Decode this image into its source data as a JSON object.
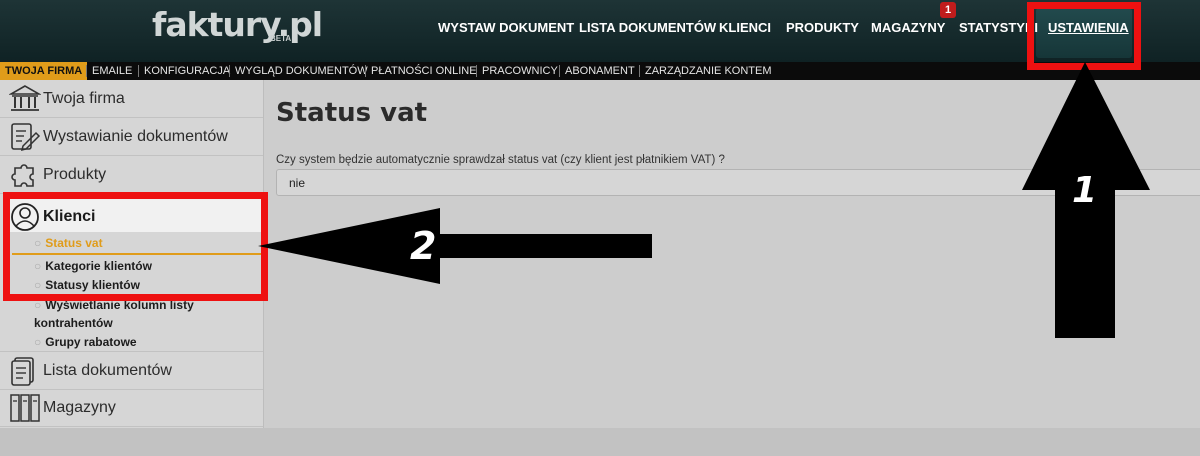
{
  "app": {
    "logo": "faktury.pl",
    "logo_badge": "BETA"
  },
  "topnav": {
    "items": [
      {
        "label": "WYSTAW DOKUMENT"
      },
      {
        "label": "LISTA DOKUMENTÓW"
      },
      {
        "label": "KLIENCI"
      },
      {
        "label": "PRODUKTY"
      },
      {
        "label": "MAGAZYNY"
      },
      {
        "label": "STATYSTYKI"
      },
      {
        "label": "USTAWIENIA"
      }
    ],
    "magazyny_badge": "1",
    "active": "USTAWIENIA"
  },
  "subnav": {
    "items": [
      {
        "label": "TWOJA FIRMA"
      },
      {
        "label": "EMAILE"
      },
      {
        "label": "KONFIGURACJA"
      },
      {
        "label": "WYGLĄD DOKUMENTÓW"
      },
      {
        "label": "PŁATNOŚCI ONLINE"
      },
      {
        "label": "PRACOWNICY"
      },
      {
        "label": "ABONAMENT"
      },
      {
        "label": "ZARZĄDZANIE KONTEM"
      }
    ]
  },
  "sidebar": {
    "items": [
      {
        "label": "Twoja firma",
        "icon": "bank-icon"
      },
      {
        "label": "Wystawianie dokumentów",
        "icon": "document-edit-icon"
      },
      {
        "label": "Produkty",
        "icon": "puzzle-icon"
      },
      {
        "label": "Klienci",
        "icon": "user-icon"
      },
      {
        "label": "Lista dokumentów",
        "icon": "document-list-icon"
      },
      {
        "label": "Magazyny",
        "icon": "binders-icon"
      }
    ],
    "klienci_sub": [
      {
        "label": "Status vat",
        "active": true
      },
      {
        "label": "Kategorie klientów"
      },
      {
        "label": "Statusy klientów"
      },
      {
        "label": "Wyświetlanie kolumn listy"
      },
      {
        "label": "kontrahentów"
      },
      {
        "label": "Grupy rabatowe"
      }
    ]
  },
  "main": {
    "title": "Status vat",
    "field_label": "Czy system będzie automatycznie sprawdzał status vat (czy klient jest płatnikiem VAT) ?",
    "field_value": "nie"
  },
  "annotations": {
    "arrow1_label": "1",
    "arrow2_label": "2"
  },
  "colors": {
    "accent_orange": "#e09c1a",
    "highlight_red": "#ee1111",
    "topbar": "#1e3436"
  }
}
